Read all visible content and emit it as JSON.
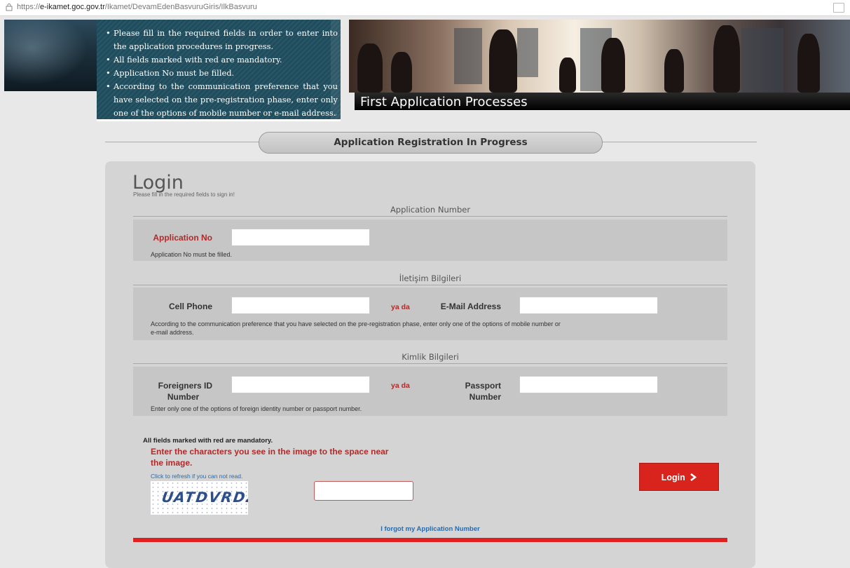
{
  "browser": {
    "url_prefix": "https://",
    "url_domain": "e-ikamet.goc.gov.tr",
    "url_path": "/Ikamet/DevamEdenBasvuruGiris/IlkBasvuru"
  },
  "header": {
    "notice_items": [
      "Please fill in the required fields in order to enter into the application procedures in progress.",
      "All fields marked with red are mandatory.",
      "Application No must be filled.",
      "According to the communication preference that you have selected on the pre-registration phase, enter only one of the options of mobile number or e-mail address."
    ],
    "banner_title": "First Application Processes"
  },
  "section_title": "Application Registration In Progress",
  "login": {
    "title": "Login",
    "subtitle": "Please fill in the required fields to sign in!",
    "application_group": {
      "heading": "Application Number",
      "label": "Application No",
      "hint": "Application No must be filled.",
      "value": ""
    },
    "contact_group": {
      "heading": "İletişim Bilgileri",
      "phone_label": "Cell Phone",
      "or": "ya da",
      "email_label": "E-Mail Address",
      "hint_line1": "According to the communication preference that you have selected on the pre-registration phase, enter only one of the options of mobile number or",
      "hint_line2": "e-mail address."
    },
    "identity_group": {
      "heading": "Kimlik Bilgileri",
      "foreign_id_label_1": "Foreigners ID",
      "foreign_id_label_2": "Number",
      "or": "ya da",
      "passport_label_1": "Passport",
      "passport_label_2": "Number",
      "hint": "Enter only one of the options of foreign identity number or passport number."
    },
    "mandatory_note": "All fields marked with red are mandatory.",
    "captcha_instruction": "Enter the characters you see in the image to the space near the image.",
    "captcha_refresh": "Click to refresh if you can not read.",
    "captcha_text": "UATDVRDZ",
    "login_button": "Login",
    "login_button_icon": "chevron-right-icon",
    "forgot_link": "I forgot my Application Number"
  },
  "colors": {
    "accent_red": "#d8241c",
    "label_red": "#b02a2a",
    "link_blue": "#2a6aa8",
    "notice_bg": "#1f4d5e"
  }
}
